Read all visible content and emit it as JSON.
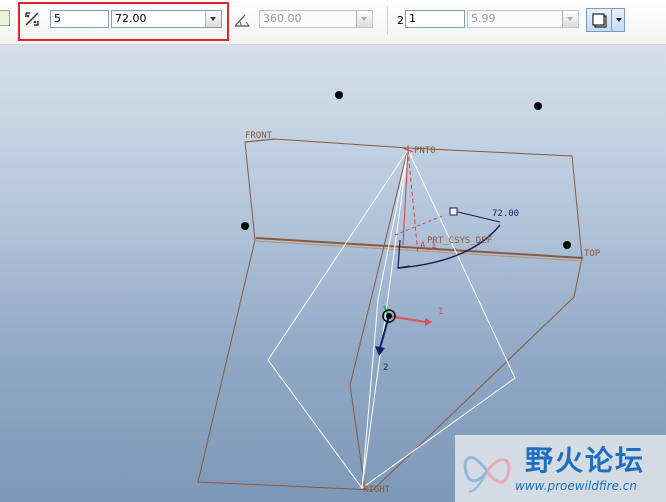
{
  "toolbar": {
    "instances_value": "5",
    "spacing_value": "72.00",
    "extent_value": "360.00",
    "second_dir_label": "2",
    "second_count_value": "1",
    "second_spacing_value": "5.99"
  },
  "model": {
    "datum_front": "FRONT",
    "datum_top": "TOP",
    "datum_right": "RIGHT",
    "datum_point": "PNT0",
    "csys_label": "PRT_CSYS_DEF",
    "axis_label": "A_1",
    "dim_value": "72.00",
    "axis_x_label": "1",
    "axis_z_label": "2"
  },
  "watermark": {
    "title": "野火论坛",
    "url": "www.proewildfire.cn"
  },
  "colors": {
    "highlight": "#e0262a",
    "datum_plane": "#8a5a3c",
    "geometry": "#ffffff",
    "dimension": "#1a1a5a",
    "axis": "#d64040"
  }
}
